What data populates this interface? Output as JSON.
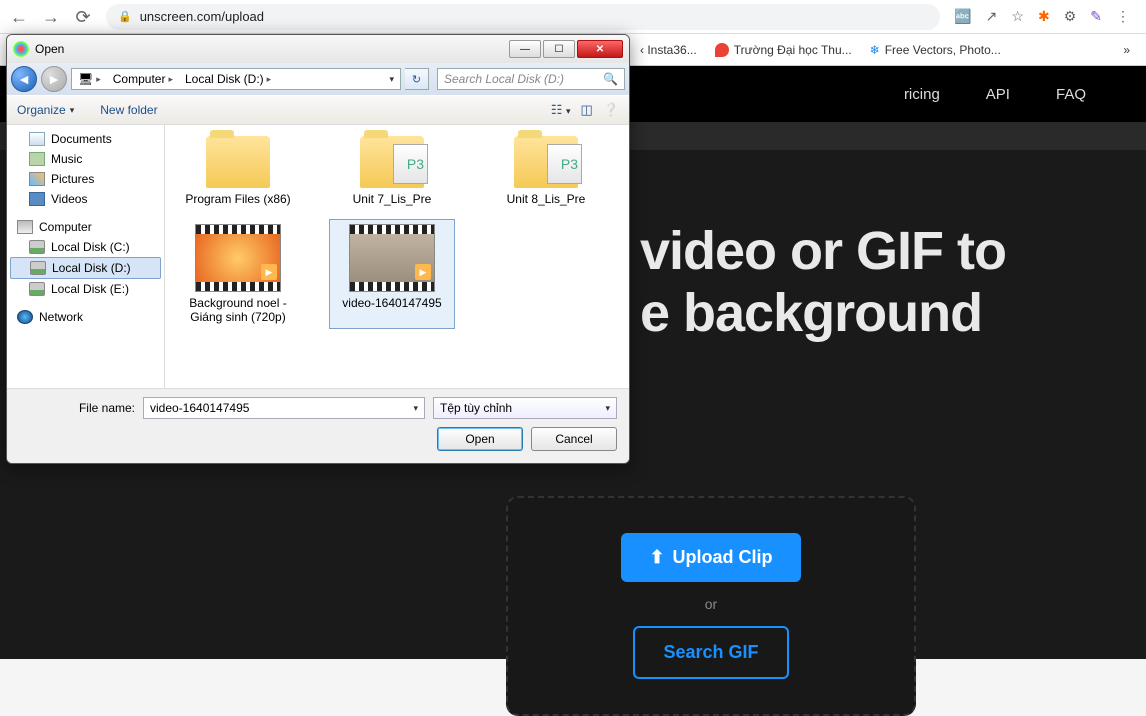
{
  "browser": {
    "url": "unscreen.com/upload",
    "bookmarks": [
      {
        "label": "‹ Insta36...",
        "color": "#333"
      },
      {
        "label": "Trường Đại học Thu...",
        "color": "#e53935"
      },
      {
        "label": "Free Vectors, Photo...",
        "color": "#1976d2"
      }
    ],
    "bookmark_overflow": "»"
  },
  "page": {
    "nav": {
      "pricing": "ricing",
      "api": "API",
      "faq": "FAQ"
    },
    "hero_line1": "video or GIF to",
    "hero_line2": "e background",
    "upload_btn": "Upload Clip",
    "or": "or",
    "search_btn": "Search GIF"
  },
  "dialog": {
    "title": "Open",
    "crumbs": {
      "root_icon": "🖥",
      "computer": "Computer",
      "disk": "Local Disk (D:)"
    },
    "search_placeholder": "Search Local Disk (D:)",
    "toolbar": {
      "organize": "Organize",
      "newfolder": "New folder"
    },
    "tree": {
      "libs": [
        {
          "label": "Documents",
          "ico": "doc"
        },
        {
          "label": "Music",
          "ico": "mus"
        },
        {
          "label": "Pictures",
          "ico": "pic"
        },
        {
          "label": "Videos",
          "ico": "vid"
        }
      ],
      "computer": "Computer",
      "drives": [
        {
          "label": "Local Disk (C:)"
        },
        {
          "label": "Local Disk (D:)",
          "selected": true
        },
        {
          "label": "Local Disk (E:)"
        }
      ],
      "network": "Network"
    },
    "files_row1": [
      {
        "label": "Program Files (x86)",
        "type": "folder"
      },
      {
        "label": "Unit 7_Lis_Pre",
        "type": "folder-mp3"
      },
      {
        "label": "Unit 8_Lis_Pre",
        "type": "folder-mp3"
      }
    ],
    "files_row2": [
      {
        "label": "Background noel - Giáng sinh (720p)",
        "type": "video-orange"
      },
      {
        "label": "video-1640147495",
        "type": "video-grey",
        "selected": true
      }
    ],
    "filename_label": "File name:",
    "filename_value": "video-1640147495",
    "filter_label": "Tệp tùy chỉnh",
    "open_btn": "Open",
    "cancel_btn": "Cancel"
  }
}
